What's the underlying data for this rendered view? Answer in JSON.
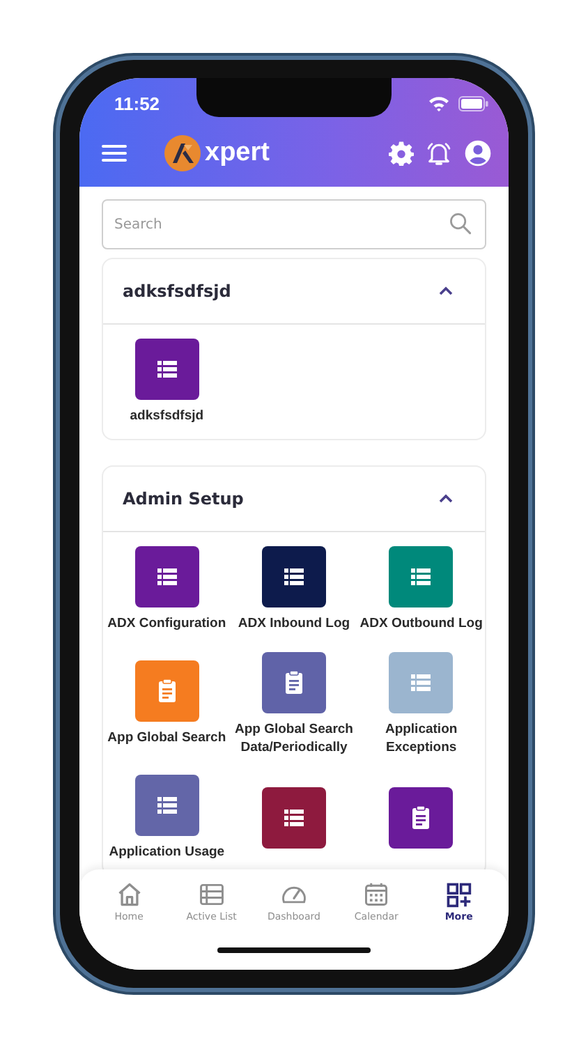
{
  "status_bar": {
    "time": "11:52"
  },
  "app_bar": {
    "logo_text": "xpert"
  },
  "search": {
    "placeholder": "Search"
  },
  "sections": [
    {
      "title": "adksfsdfsjd",
      "expanded": true,
      "items": [
        {
          "label": "adksfsdfsjd",
          "color": "#6a1b9a",
          "kind": "list"
        }
      ]
    },
    {
      "title": "Admin Setup",
      "expanded": true,
      "items": [
        {
          "label": "ADX Configuration",
          "color": "#6a1b9a",
          "kind": "list"
        },
        {
          "label": "ADX Inbound Log",
          "color": "#0d1b4c",
          "kind": "list"
        },
        {
          "label": "ADX Outbound Log",
          "color": "#00897b",
          "kind": "list"
        },
        {
          "label": "App Global Search",
          "color": "#f57c20",
          "kind": "clipboard"
        },
        {
          "label": "App Global Search Data/Periodically",
          "color": "#6063a8",
          "kind": "clipboard"
        },
        {
          "label": "Application Exceptions",
          "color": "#9bb5cf",
          "kind": "list"
        },
        {
          "label": "Application Usage",
          "color": "#6366a8",
          "kind": "list"
        },
        {
          "color": "#8e1a3e",
          "kind": "list"
        },
        {
          "color": "#6a1b9a",
          "kind": "clipboard"
        }
      ]
    }
  ],
  "bottom_nav": [
    {
      "label": "Home",
      "selected": false
    },
    {
      "label": "Active List",
      "selected": false
    },
    {
      "label": "Dashboard",
      "selected": false
    },
    {
      "label": "Calendar",
      "selected": false
    },
    {
      "label": "More",
      "selected": true
    }
  ]
}
